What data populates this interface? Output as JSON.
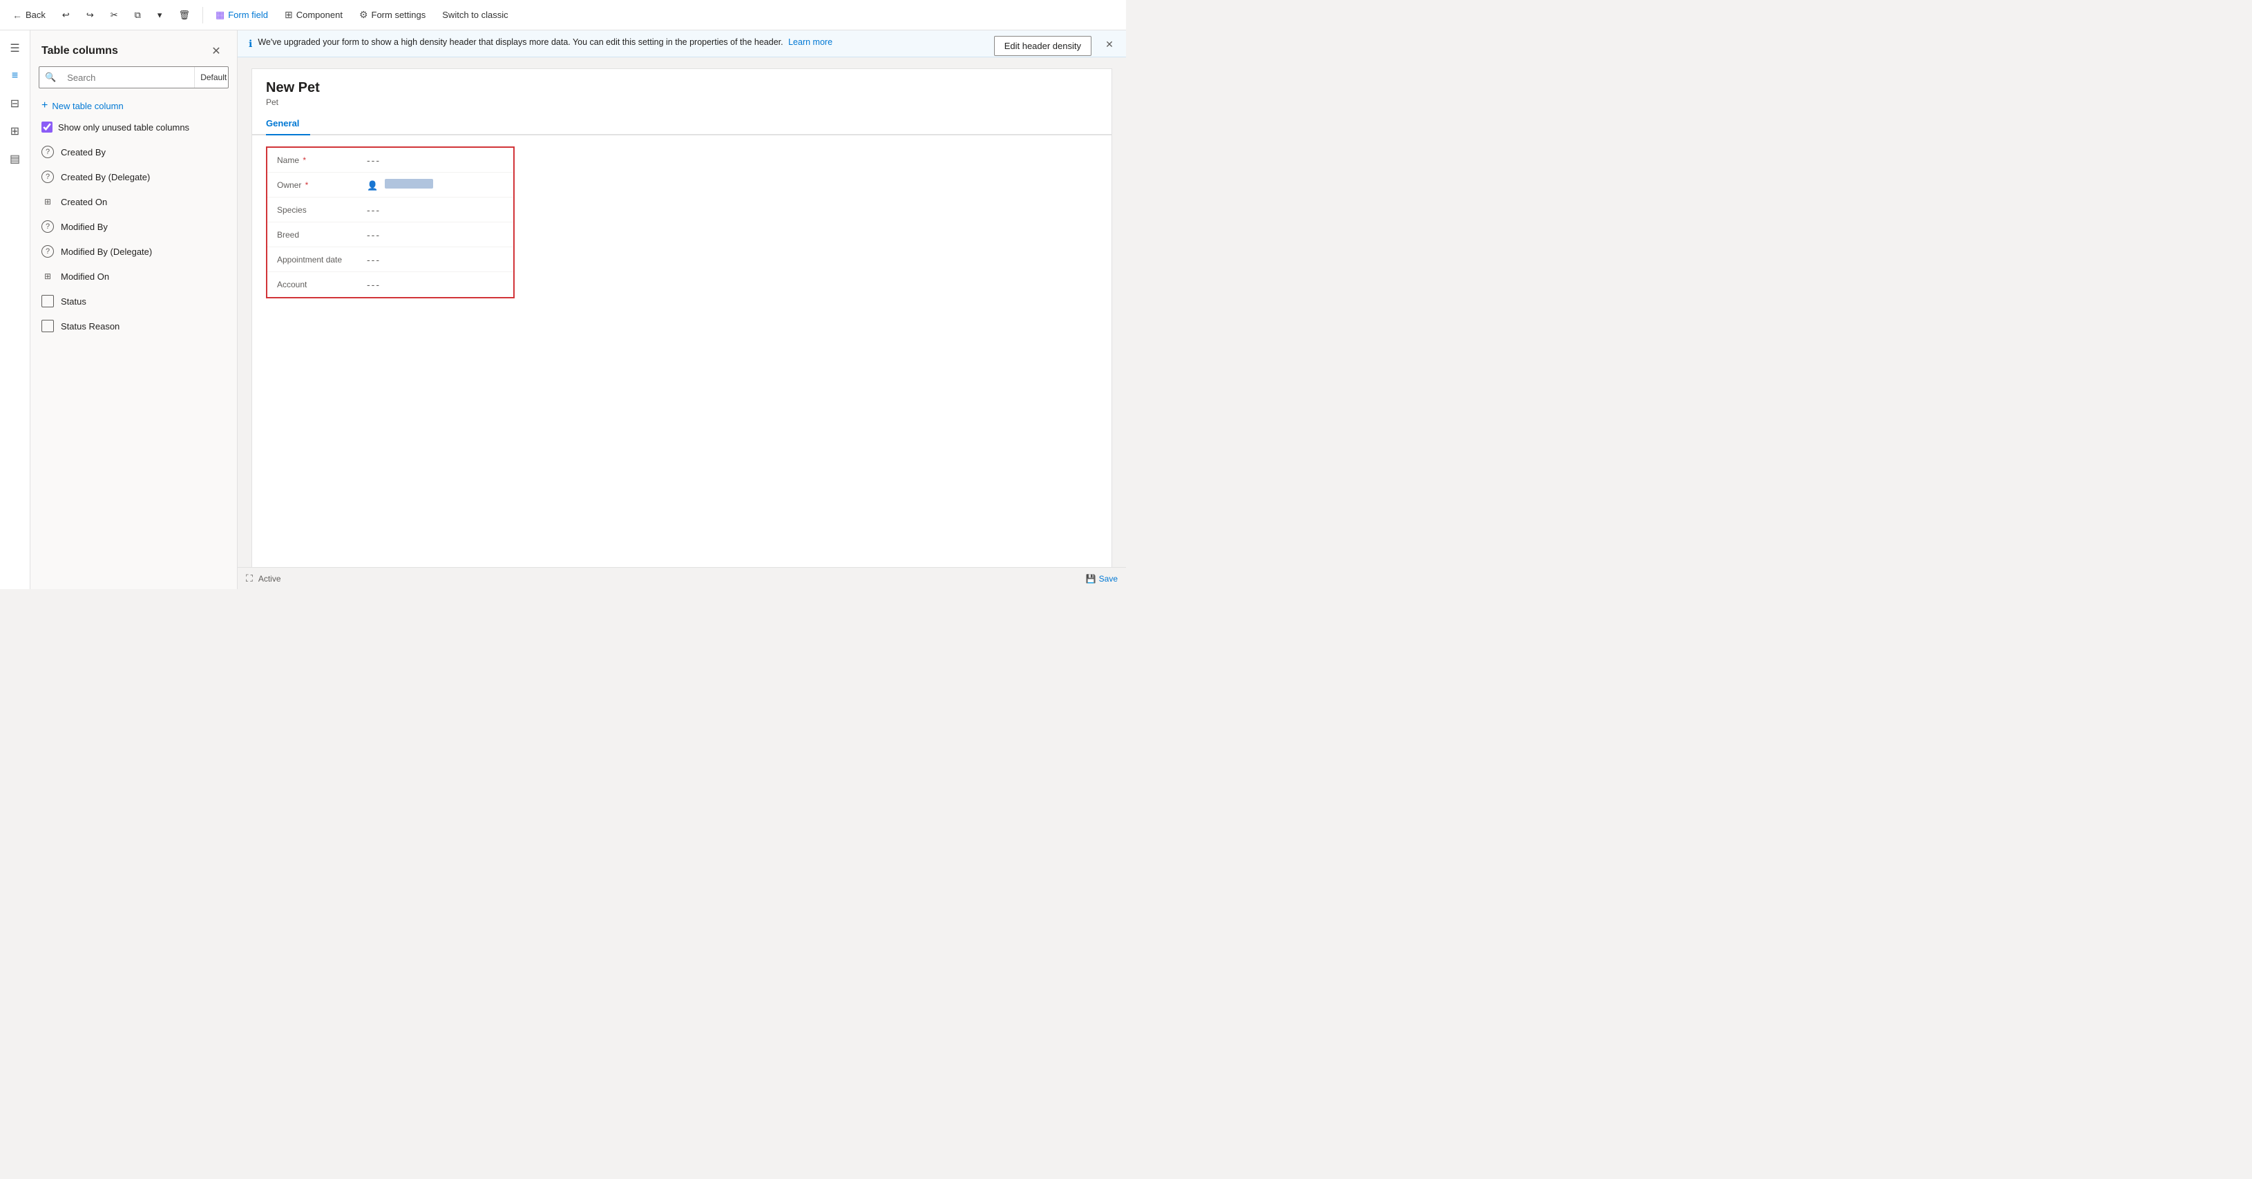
{
  "toolbar": {
    "back_label": "Back",
    "undo_title": "Undo",
    "redo_title": "Redo",
    "cut_title": "Cut",
    "copy_title": "Copy",
    "delete_title": "Delete",
    "form_field_label": "Form field",
    "component_label": "Component",
    "form_settings_label": "Form settings",
    "switch_classic_label": "Switch to classic"
  },
  "left_panel": {
    "title": "Table columns",
    "search_placeholder": "Search",
    "search_filter": "Default",
    "new_column_label": "New table column",
    "show_unused_label": "Show only unused table columns",
    "show_unused_checked": true,
    "columns": [
      {
        "id": "created-by",
        "label": "Created By",
        "icon_type": "question"
      },
      {
        "id": "created-by-delegate",
        "label": "Created By (Delegate)",
        "icon_type": "question"
      },
      {
        "id": "created-on",
        "label": "Created On",
        "icon_type": "grid"
      },
      {
        "id": "modified-by",
        "label": "Modified By",
        "icon_type": "question"
      },
      {
        "id": "modified-by-delegate",
        "label": "Modified By (Delegate)",
        "icon_type": "question"
      },
      {
        "id": "modified-on",
        "label": "Modified On",
        "icon_type": "grid"
      },
      {
        "id": "status",
        "label": "Status",
        "icon_type": "box"
      },
      {
        "id": "status-reason",
        "label": "Status Reason",
        "icon_type": "box"
      }
    ]
  },
  "info_banner": {
    "message": "We've upgraded your form to show a high density header that displays more data. You can edit this setting in the properties of the header.",
    "learn_more_label": "Learn more"
  },
  "edit_density_btn": "Edit header density",
  "form": {
    "record_title": "New Pet",
    "record_type": "Pet",
    "tabs": [
      {
        "id": "general",
        "label": "General",
        "active": true
      }
    ],
    "fields": [
      {
        "id": "name",
        "label": "Name",
        "required": true,
        "value": "---",
        "type": "text"
      },
      {
        "id": "owner",
        "label": "Owner",
        "required": true,
        "value": "",
        "type": "owner"
      },
      {
        "id": "species",
        "label": "Species",
        "required": false,
        "value": "---",
        "type": "text"
      },
      {
        "id": "breed",
        "label": "Breed",
        "required": false,
        "value": "---",
        "type": "text"
      },
      {
        "id": "appointment-date",
        "label": "Appointment date",
        "required": false,
        "value": "---",
        "type": "text"
      },
      {
        "id": "account",
        "label": "Account",
        "required": false,
        "value": "---",
        "type": "text"
      }
    ]
  },
  "bottom_bar": {
    "status": "Active",
    "save_label": "Save",
    "expand_label": "⛶"
  },
  "icons": {
    "back": "←",
    "undo": "↩",
    "redo": "↪",
    "cut": "✂",
    "copy": "⧉",
    "delete": "🗑",
    "form_field": "▦",
    "component": "⊞",
    "form_settings": "⚙",
    "switch_classic": "↔",
    "close": "✕",
    "search": "🔍",
    "chevron_down": "▾",
    "plus": "+",
    "check": "✓",
    "info": "ℹ",
    "owner_person": "👤",
    "expand": "⛶",
    "save": "💾",
    "hamburger": "☰",
    "layers": "⊞",
    "table": "⊟",
    "chart": "📊"
  }
}
